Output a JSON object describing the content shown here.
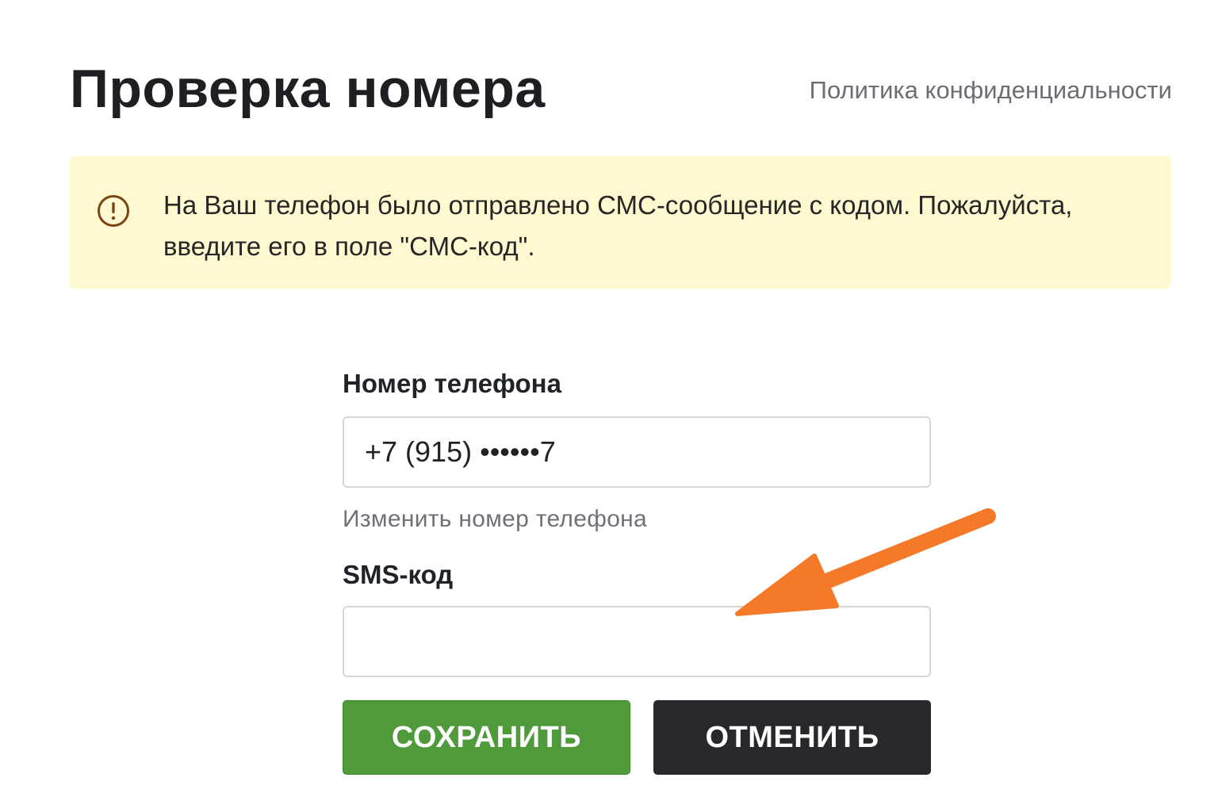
{
  "header": {
    "title": "Проверка номера",
    "privacy_link": "Политика конфиденциальности"
  },
  "alert": {
    "icon": "exclamation-circle-icon",
    "message": "На Ваш телефон было отправлено СМС-сообщение с кодом. Пожалуйста, введите его в поле \"СМС-код\".",
    "background_color": "#fef9d0",
    "icon_color": "#7a4416"
  },
  "form": {
    "phone_label": "Номер телефона",
    "phone_value": "+7 (915) ••••••7",
    "change_phone_link": "Изменить номер телефона",
    "sms_label": "SMS-код",
    "sms_value": ""
  },
  "buttons": {
    "save_label": "СОХРАНИТЬ",
    "cancel_label": "ОТМЕНИТЬ",
    "save_color": "#4f9b3b",
    "cancel_color": "#26282c"
  },
  "annotation": {
    "arrow_color": "#f47a2a"
  }
}
